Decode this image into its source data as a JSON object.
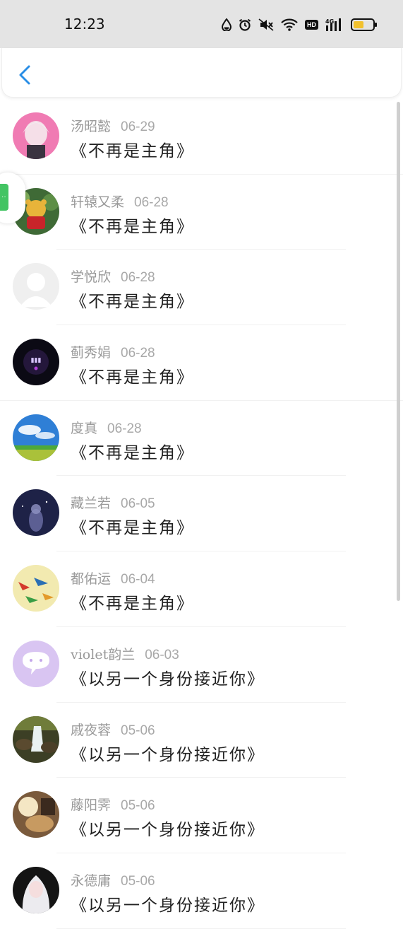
{
  "status_bar": {
    "time": "12:23",
    "icons": [
      "drop-icon",
      "alarm-icon",
      "mute-icon",
      "wifi-icon",
      "hd-icon",
      "signal-icon",
      "battery-icon"
    ],
    "hd": "HD",
    "network": "4G",
    "battery_level": 0.55,
    "battery_color": "#f2c12e"
  },
  "header": {
    "back_icon": "chevron-left-icon",
    "accent": "#2a8ee6"
  },
  "items": [
    {
      "name": "汤昭懿",
      "date": "06-29",
      "title": "《不再是主角》"
    },
    {
      "name": "轩辕又柔",
      "date": "06-28",
      "title": "《不再是主角》"
    },
    {
      "name": "学悦欣",
      "date": "06-28",
      "title": "《不再是主角》"
    },
    {
      "name": "蓟秀娟",
      "date": "06-28",
      "title": "《不再是主角》"
    },
    {
      "name": "度真",
      "date": "06-28",
      "title": "《不再是主角》"
    },
    {
      "name": "藏兰若",
      "date": "06-05",
      "title": "《不再是主角》"
    },
    {
      "name": "都佑运",
      "date": "06-04",
      "title": "《不再是主角》"
    },
    {
      "name": "violet韵兰",
      "date": "06-03",
      "title": "《以另一个身份接近你》"
    },
    {
      "name": "戚夜蓉",
      "date": "05-06",
      "title": "《以另一个身份接近你》"
    },
    {
      "name": "藤阳霁",
      "date": "05-06",
      "title": "《以另一个身份接近你》"
    },
    {
      "name": "永德庸",
      "date": "05-06",
      "title": "《以另一个身份接近你》"
    }
  ]
}
